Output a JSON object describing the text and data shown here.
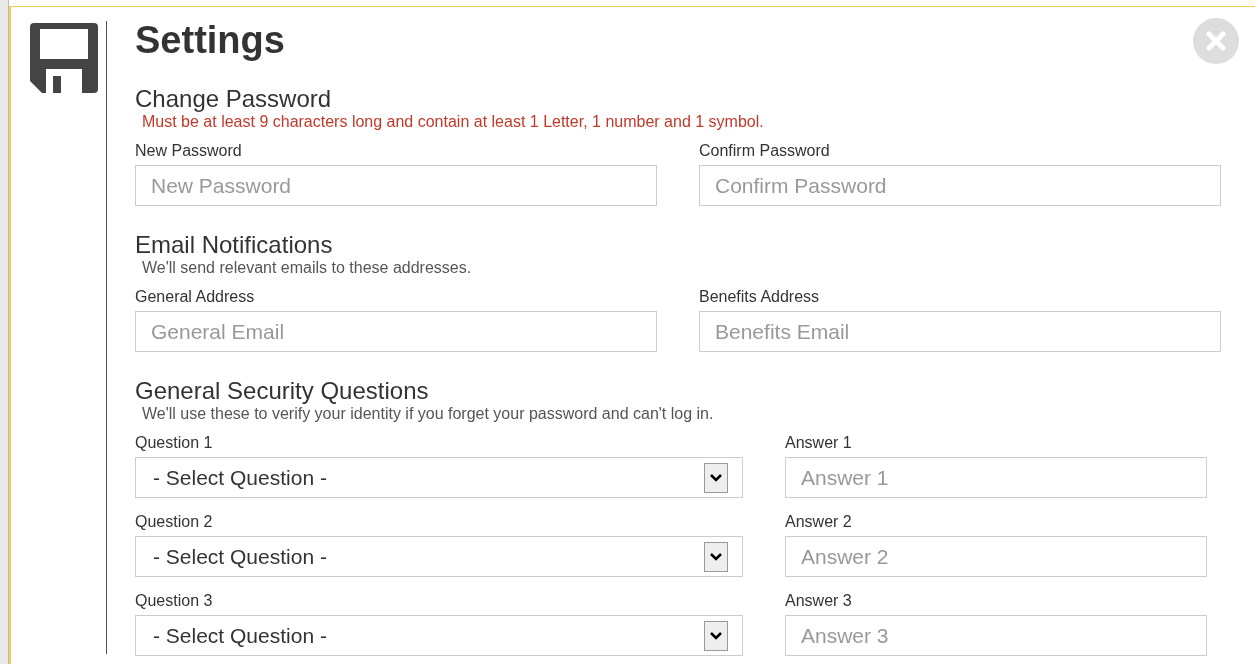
{
  "dialog": {
    "title": "Settings"
  },
  "sections": [
    {
      "title": "Change Password",
      "note": "Must be at least 9 characters long and contain at least 1 Letter, 1 number and 1 symbol.",
      "color": "#c0392b",
      "fields": [
        {
          "kind": "input",
          "label": "New Password",
          "placeholder": "New Password"
        },
        {
          "kind": "input",
          "label": "Confirm Password",
          "placeholder": "Confirm Password"
        }
      ]
    },
    {
      "title": "Email Notifications",
      "note": "We'll send relevant emails to these addresses.",
      "color": "#555555",
      "fields": [
        {
          "kind": "input",
          "label": "General Address",
          "placeholder": "General Email"
        },
        {
          "kind": "input",
          "label": "Benefits Address",
          "placeholder": "Benefits Email"
        }
      ]
    },
    {
      "title": "General Security Questions",
      "note": "We'll use these to verify your identity if you forget your password and can't log in.",
      "color": "#555555",
      "fields": [
        {
          "kind": "select",
          "label": "Question 1",
          "value": "- Select Question -"
        },
        {
          "kind": "input",
          "label": "Answer 1",
          "placeholder": "Answer 1"
        },
        {
          "kind": "select",
          "label": "Question 2",
          "value": "- Select Question -"
        },
        {
          "kind": "input",
          "label": "Answer 2",
          "placeholder": "Answer 2"
        },
        {
          "kind": "select",
          "label": "Question 3",
          "value": "- Select Question -"
        },
        {
          "kind": "input",
          "label": "Answer 3",
          "placeholder": "Answer 3"
        }
      ]
    }
  ]
}
